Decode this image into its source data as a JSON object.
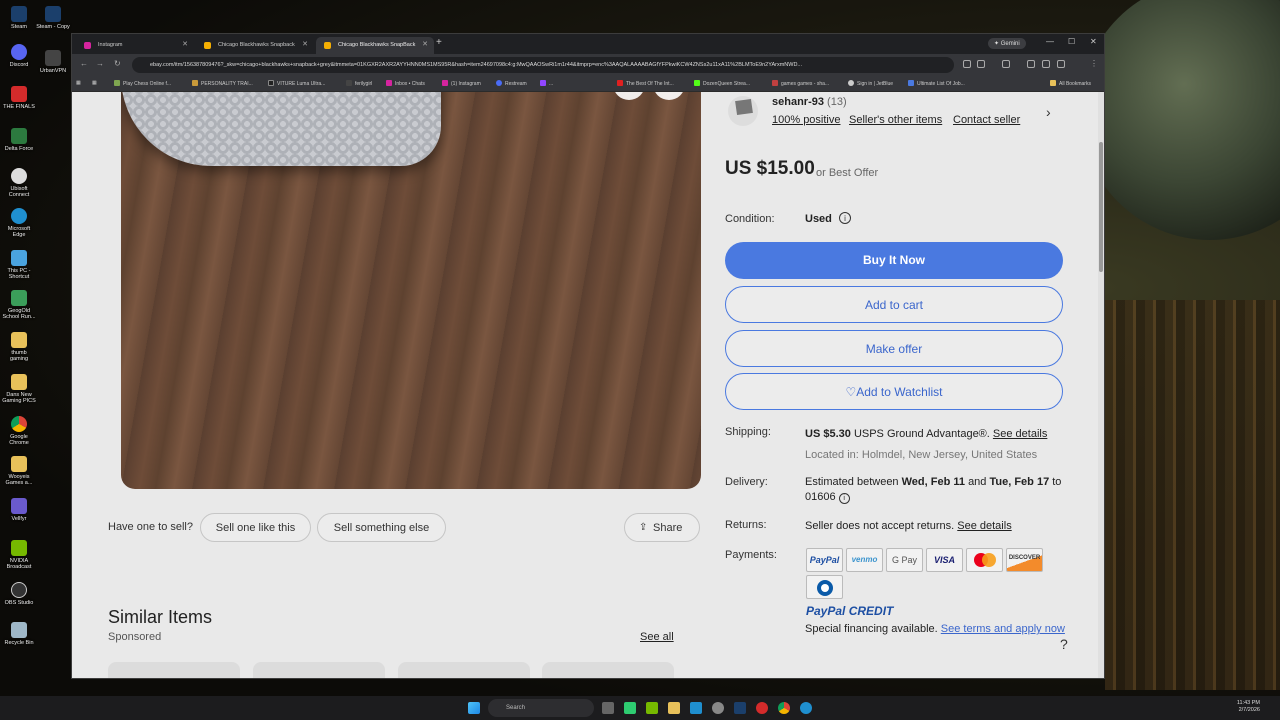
{
  "desktop": {
    "icons": [
      "Steam",
      "Steam - Copy",
      "Discord",
      "UrbanVPN",
      "THE FINALS",
      "Delta Force",
      "Ubisoft Connect",
      "Microsoft Edge",
      "This PC - Shortcut",
      "GeogOld School Run...",
      "thumb gaming",
      "Dans New Gaming PICS",
      "Google Chrome",
      "Wooyeis Games a...",
      "Vellfyr",
      "NVIDIA Broadcast",
      "OBS Studio",
      "Recycle Bin"
    ]
  },
  "browser": {
    "tabs": [
      {
        "label": "Instagram"
      },
      {
        "label": "Chicago Blackhawks Snapback"
      },
      {
        "label": "Chicago Blackhawks SnapBack"
      }
    ],
    "gemini_label": "Gemini",
    "url": "ebay.com/itm/156387809476?_skw=chicago+blackhawks+snapback+grey&itmmeta=01KGXR2AXR2AYYHNN0MS1MS95R&hash=item24697098c4:g:MwQAAOSwRi1m1r44&itmprp=enc%3AAQALAAAABAGfYFPkwiKCW4ZNSs2u11xA11%2BLMToE9n2YArxmNWD...",
    "bookmarks": [
      "Play Chess Online f...",
      "PERSONALITY TRAI...",
      "VITURE Luma Ultra...",
      "ferilygirl",
      "Inbox • Chats",
      "(1) Instagram",
      "Restream",
      "...",
      "The Best Of The Int...",
      "DozenQueen Strea...",
      "games games - sha...",
      "Sign in | JetBlue",
      "Ultimate List Of Job..."
    ],
    "all_bookmarks": "All Bookmarks"
  },
  "listing": {
    "seller": {
      "name": "sehanr-93",
      "count": "(13)",
      "positive": "100% positive",
      "other_items": "Seller's other items",
      "contact": "Contact seller"
    },
    "price": "US $15.00",
    "best_offer": "or Best Offer",
    "condition_label": "Condition:",
    "condition_value": "Used",
    "buy_now": "Buy It Now",
    "add_to_cart": "Add to cart",
    "make_offer": "Make offer",
    "add_to_watchlist": "♡Add to Watchlist",
    "shipping_label": "Shipping:",
    "shipping_price": "US $5.30",
    "shipping_service": "USPS Ground Advantage®.",
    "see_details": "See details",
    "located_in": "Located in: Holmdel, New Jersey, United States",
    "delivery_label": "Delivery:",
    "delivery_prefix": "Estimated between",
    "delivery_start": "Wed, Feb 11",
    "delivery_and": "and",
    "delivery_end": "Tue, Feb 17",
    "delivery_to": "to",
    "delivery_zip": "01606",
    "returns_label": "Returns:",
    "returns_text": "Seller does not accept returns.",
    "payments_label": "Payments:",
    "payment_methods": [
      "PayPal",
      "venmo",
      "G Pay",
      "VISA",
      "Mastercard",
      "DISCOVER",
      "Diners"
    ],
    "paypal_credit": "PayPal CREDIT",
    "financing_text": "Special financing available.",
    "financing_link": "See terms and apply now",
    "help": "?"
  },
  "sell": {
    "question": "Have one to sell?",
    "sell_one": "Sell one like this",
    "sell_else": "Sell something else",
    "share": "Share"
  },
  "similar": {
    "title": "Similar Items",
    "sponsored": "Sponsored",
    "see_all": "See all"
  },
  "taskbar": {
    "search": "Search",
    "time": "11:43 PM",
    "date": "2/7/2026"
  }
}
